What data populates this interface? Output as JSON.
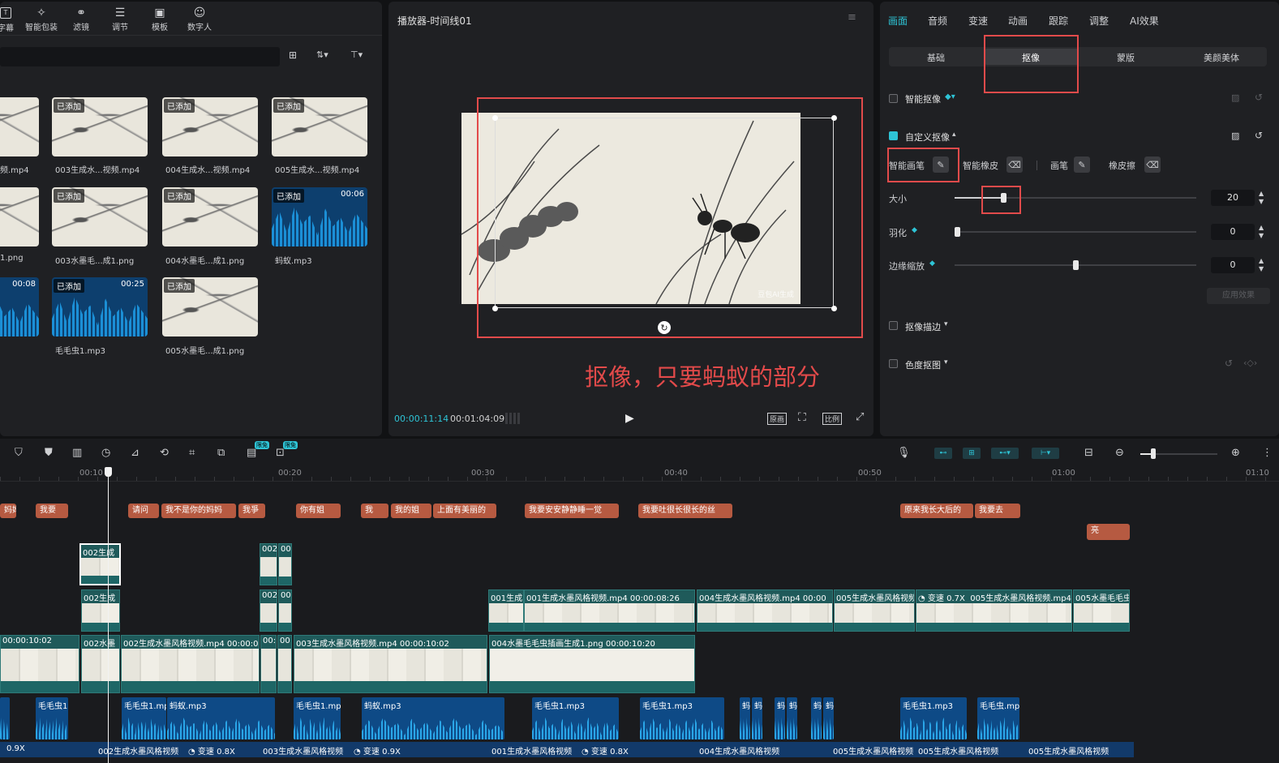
{
  "media_toolbar": {
    "items": [
      {
        "label": "字幕",
        "icon": "subtitle-icon"
      },
      {
        "label": "智能包装",
        "icon": "sparkle-box-icon"
      },
      {
        "label": "滤镜",
        "icon": "filter-icon"
      },
      {
        "label": "调节",
        "icon": "adjust-icon"
      },
      {
        "label": "模板",
        "icon": "template-icon"
      },
      {
        "label": "数字人",
        "icon": "avatar-icon"
      }
    ]
  },
  "media": {
    "added_badge": "已添加",
    "items": [
      {
        "name": "频.mp4",
        "added": false,
        "duration": ""
      },
      {
        "name": "003生成水...视频.mp4",
        "added": true,
        "duration": ""
      },
      {
        "name": "004生成水...视频.mp4",
        "added": true,
        "duration": ""
      },
      {
        "name": "005生成水...视频.mp4",
        "added": true,
        "duration": ""
      },
      {
        "name": "1.png",
        "added": false,
        "duration": ""
      },
      {
        "name": "003水墨毛...成1.png",
        "added": true,
        "duration": ""
      },
      {
        "name": "004水墨毛...成1.png",
        "added": true,
        "duration": ""
      },
      {
        "name": "蚂蚁.mp3",
        "added": true,
        "duration": "00:06"
      },
      {
        "name": "",
        "added": false,
        "duration": "00:08"
      },
      {
        "name": "毛毛虫1.mp3",
        "added": true,
        "duration": "00:25"
      },
      {
        "name": "005水墨毛...成1.png",
        "added": true,
        "duration": ""
      }
    ]
  },
  "player": {
    "title": "播放器-时间线01",
    "current_time": "00:00:11:14",
    "total_time": "00:01:04:09",
    "btn_original": "原画",
    "btn_ratio": "比例",
    "watermark": "豆包AI生成",
    "annotation": "抠像，只要蚂蚁的部分"
  },
  "inspector": {
    "tabs": [
      "画面",
      "音频",
      "变速",
      "动画",
      "跟踪",
      "调整",
      "AI效果"
    ],
    "active_tab": "画面",
    "subtabs": [
      "基础",
      "抠像",
      "蒙版",
      "美颜美体"
    ],
    "active_subtab": "抠像",
    "smart_cutout": "智能抠像",
    "custom_cutout": "自定义抠像",
    "tools": [
      "智能画笔",
      "智能橡皮",
      "画笔",
      "橡皮擦"
    ],
    "size_label": "大小",
    "size_value": "20",
    "size_pct": 0.2,
    "feather_label": "羽化",
    "feather_value": "0",
    "edge_label": "边缘缩放",
    "edge_value": "0",
    "apply_btn": "应用效果",
    "stroke": "抠像描边",
    "chroma": "色度抠图"
  },
  "timeline": {
    "ruler": [
      "00:10",
      "00:20",
      "00:30",
      "00:40",
      "00:50",
      "01:00",
      "01:10"
    ],
    "limited_badge": "限免",
    "text_chips": [
      "妈妈",
      "我要",
      "请问",
      "我不是你的妈妈",
      "我爭",
      "你有姐",
      "我",
      "我的姐",
      "上面有美丽的",
      "我要安安静静睡一觉",
      "我要吐很长很长的丝",
      "原来我长大后的",
      "我要去",
      "亮"
    ],
    "video_top": [
      "002生成",
      "002",
      "00"
    ],
    "video_mid": [
      "002生成",
      "002",
      "00",
      "001生成",
      "001生成水墨风格视频.mp4  00:00:08:26",
      "004生成水墨风格视频.mp4  00:00",
      "005生成水墨风格视频",
      "变速 0.7X",
      "005生成水墨风格视频.mp4",
      "005水墨毛毛虫"
    ],
    "video_main": [
      "00:00:10:02",
      "002水墨",
      "002生成水墨风格视频.mp4  00:00:07",
      "00:",
      "00",
      "003生成水墨风格视频.mp4  00:00:10:02",
      "004水墨毛毛虫插画生成1.png  00:00:10:20"
    ],
    "audio": [
      "毛毛虫1",
      "毛毛虫1.mp",
      "蚂蚁.mp3",
      "毛毛虫1.mp",
      "蚂蚁.mp3",
      "毛毛虫1.mp3",
      "毛毛虫1.mp3",
      "蚂",
      "蚂",
      "蚂",
      "蚂",
      "蚂",
      "蚂",
      "毛毛虫1.mp3",
      "毛毛虫.mp"
    ],
    "speed_row": [
      "0.9X",
      "002生成水墨风格视频",
      "变速 0.8X",
      "003生成水墨风格视频",
      "变速 0.9X",
      "001生成水墨风格视频",
      "变速 0.8X",
      "004生成水墨风格视频",
      "005生成水墨风格视频",
      "005生成水墨风格视频",
      "005生成水墨风格视频"
    ]
  }
}
